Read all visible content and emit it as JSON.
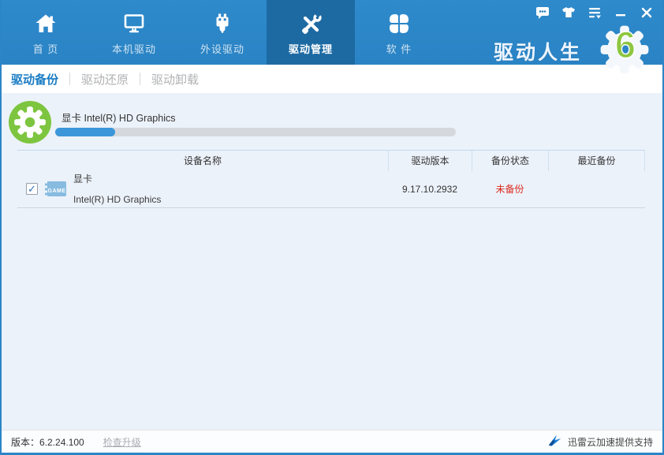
{
  "brand": {
    "name": "驱动人生",
    "badge": "6"
  },
  "titlebar": {
    "icons": [
      "feedback-icon",
      "skin-icon",
      "menu-icon",
      "minimize-icon",
      "close-icon"
    ]
  },
  "nav": {
    "items": [
      {
        "label": "首 页",
        "icon": "home-icon",
        "active": false
      },
      {
        "label": "本机驱动",
        "icon": "monitor-icon",
        "active": false
      },
      {
        "label": "外设驱动",
        "icon": "usb-plug-icon",
        "active": false
      },
      {
        "label": "驱动管理",
        "icon": "tools-icon",
        "active": true
      },
      {
        "label": "软 件",
        "icon": "apps-icon",
        "active": false
      }
    ]
  },
  "tabs": [
    {
      "label": "驱动备份",
      "active": true
    },
    {
      "label": "驱动还原",
      "active": false
    },
    {
      "label": "驱动卸载",
      "active": false
    }
  ],
  "backup": {
    "current_device": "显卡 Intel(R) HD Graphics",
    "progress_percent": 15
  },
  "table": {
    "headers": [
      "设备名称",
      "驱动版本",
      "备份状态",
      "最近备份"
    ],
    "rows": [
      {
        "checked": true,
        "check_glyph": "✓",
        "icon": "gpu-card-icon",
        "icon_text": "GAME",
        "category": "显卡",
        "device": "Intel(R) HD Graphics",
        "version": "9.17.10.2932",
        "status": "未备份",
        "last_backup": ""
      }
    ]
  },
  "statusbar": {
    "version": "版本：6.2.24.100",
    "check_update": "检查升级",
    "sponsor": "迅雷云加速提供支持",
    "sponsor_icon": "xunlei-bird-icon"
  },
  "colors": {
    "nav_blue": "#2b85c7",
    "active_tab_blue": "#1d6aa3",
    "accent_blue": "#1a7cc4",
    "progress_blue": "#3b97d9",
    "badge_green": "#7dc53f",
    "logo_green": "#8dc63f",
    "status_red": "#dc2a1e",
    "content_bg": "#ecf2fa"
  }
}
